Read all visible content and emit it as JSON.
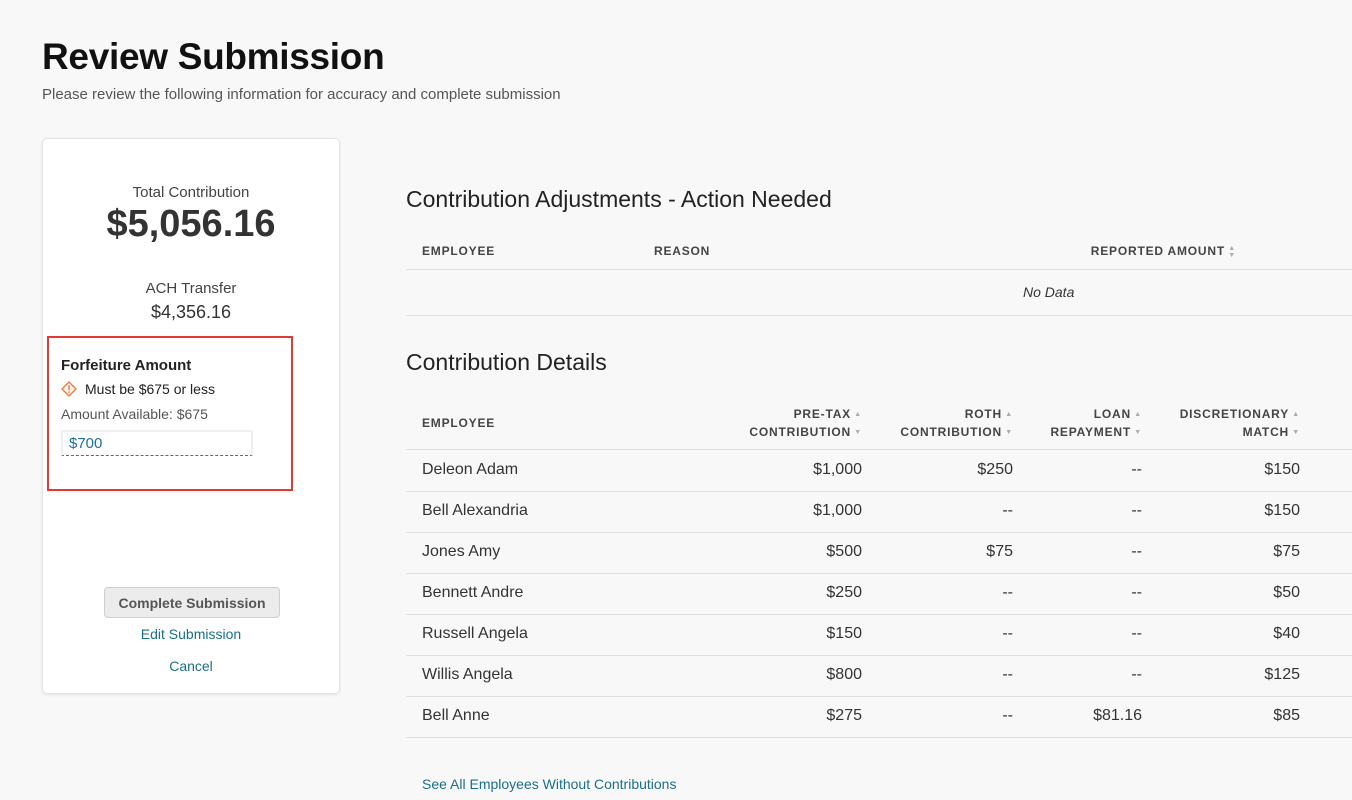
{
  "header": {
    "title": "Review Submission",
    "subtitle": "Please review the following information for accuracy and complete submission"
  },
  "summary": {
    "total_label": "Total Contribution",
    "total_value": "$5,056.16",
    "ach_label": "ACH Transfer",
    "ach_value": "$4,356.16",
    "forfeiture": {
      "title": "Forfeiture Amount",
      "error": "Must be $675 or less",
      "available": "Amount Available: $675",
      "input_value": "$700"
    },
    "complete_label": "Complete Submission",
    "edit_label": "Edit Submission",
    "cancel_label": "Cancel"
  },
  "adjustments": {
    "title": "Contribution Adjustments - Action Needed",
    "columns": [
      "EMPLOYEE",
      "REASON",
      "REPORTED AMOUNT"
    ],
    "empty_text": "No Data"
  },
  "details": {
    "title": "Contribution Details",
    "columns": [
      {
        "line1": "",
        "line2": "EMPLOYEE"
      },
      {
        "line1": "PRE-TAX",
        "line2": "CONTRIBUTION"
      },
      {
        "line1": "ROTH",
        "line2": "CONTRIBUTION"
      },
      {
        "line1": "LOAN",
        "line2": "REPAYMENT"
      },
      {
        "line1": "DISCRETIONARY",
        "line2": "MATCH"
      }
    ],
    "rows": [
      {
        "employee": "Deleon Adam",
        "pretax": "$1,000",
        "roth": "$250",
        "loan": "--",
        "match": "$150"
      },
      {
        "employee": "Bell Alexandria",
        "pretax": "$1,000",
        "roth": "--",
        "loan": "--",
        "match": "$150"
      },
      {
        "employee": "Jones Amy",
        "pretax": "$500",
        "roth": "$75",
        "loan": "--",
        "match": "$75"
      },
      {
        "employee": "Bennett Andre",
        "pretax": "$250",
        "roth": "--",
        "loan": "--",
        "match": "$50"
      },
      {
        "employee": "Russell Angela",
        "pretax": "$150",
        "roth": "--",
        "loan": "--",
        "match": "$40"
      },
      {
        "employee": "Willis Angela",
        "pretax": "$800",
        "roth": "--",
        "loan": "--",
        "match": "$125"
      },
      {
        "employee": "Bell Anne",
        "pretax": "$275",
        "roth": "--",
        "loan": "$81.16",
        "match": "$85"
      }
    ]
  },
  "footer": {
    "see_all_label": "See All Employees Without Contributions"
  },
  "icons": {
    "warning": "warning-diamond-icon",
    "sort": "sort-arrows-icon"
  },
  "colors": {
    "error_border": "#e53935",
    "warning_icon": "#e8743b",
    "link": "#1a6f8a",
    "input_text": "#1a6fa0"
  }
}
